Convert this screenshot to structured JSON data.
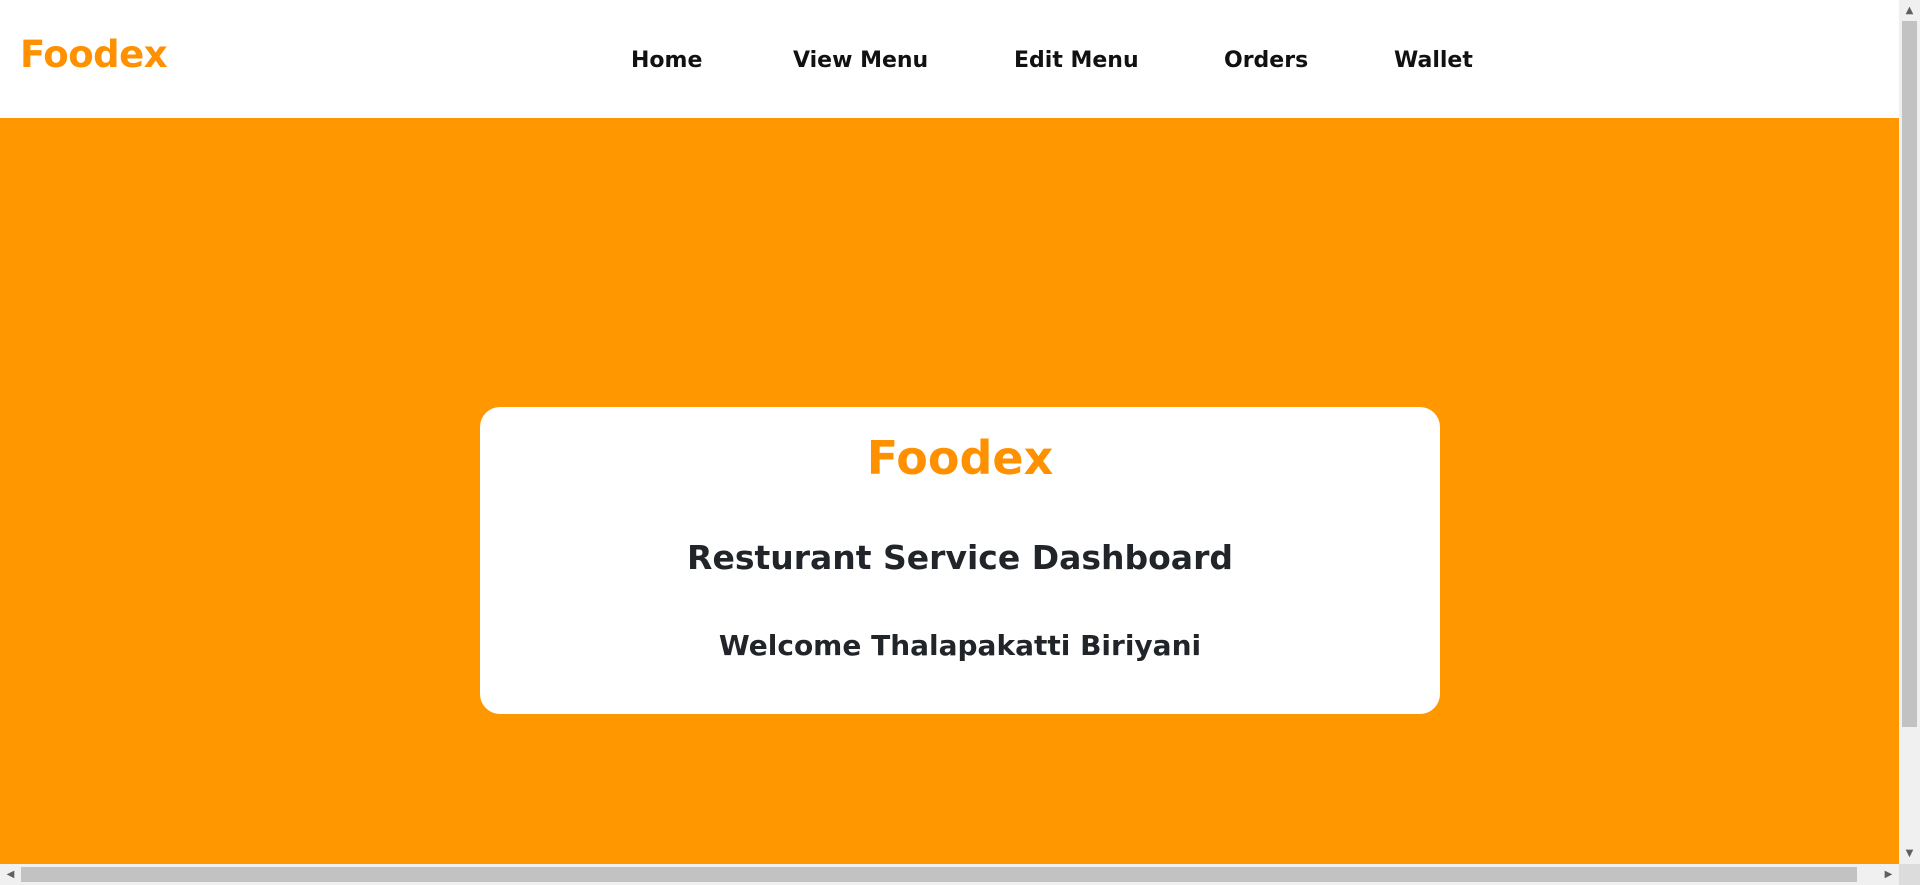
{
  "navbar": {
    "brand": "Foodex",
    "items": [
      {
        "label": "Home"
      },
      {
        "label": "View Menu"
      },
      {
        "label": "Edit Menu"
      },
      {
        "label": "Orders"
      },
      {
        "label": "Wallet"
      }
    ]
  },
  "hero": {
    "card": {
      "brand": "Foodex",
      "title": "Resturant Service Dashboard",
      "welcome": "Welcome Thalapakatti Biriyani"
    }
  },
  "scrollbars": {
    "up_icon": "▲",
    "down_icon": "▼",
    "left_icon": "◀",
    "right_icon": "▶"
  },
  "colors": {
    "accent": "#ff9800",
    "brand_text": "#ff9100",
    "heading_text": "#212529"
  }
}
